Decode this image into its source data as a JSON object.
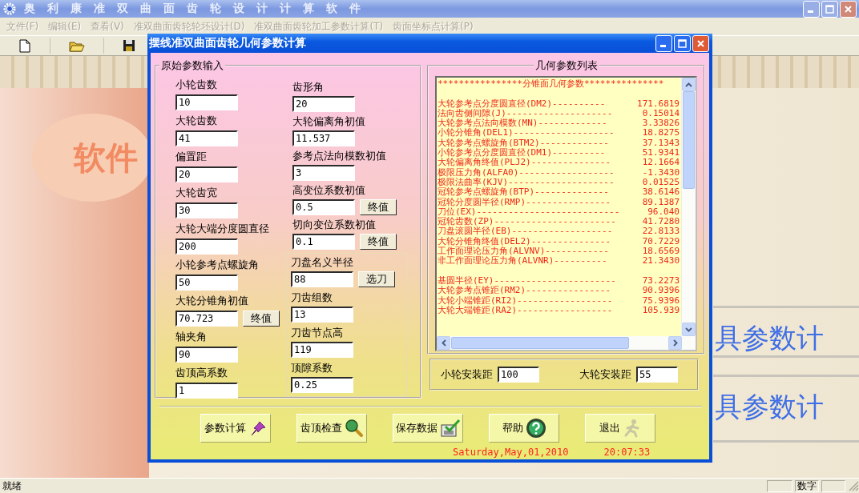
{
  "app": {
    "title": "奥利康准双曲面齿轮设计计算软件"
  },
  "menu": [
    {
      "label": "文件(F)",
      "disabled": true
    },
    {
      "label": "编辑(E)",
      "disabled": true
    },
    {
      "label": "查看(V)",
      "disabled": true
    },
    {
      "label": "准双曲面齿轮轮坯设计(D)",
      "disabled": true
    },
    {
      "label": "准双曲面齿轮加工参数计算(T)",
      "disabled": true
    },
    {
      "label": "齿面坐标点计算(P)",
      "disabled": true
    }
  ],
  "background_texts": {
    "logo": "软件",
    "line_1": "具参数计",
    "line_2": "具参数计"
  },
  "dialog": {
    "title": "摆线准双曲面齿轮几何参数计算",
    "input_group": {
      "legend": "原始参数输入",
      "left": [
        {
          "label": "小轮齿数",
          "value": "10"
        },
        {
          "label": "大轮齿数",
          "value": "41"
        },
        {
          "label": "偏置距",
          "value": "20"
        },
        {
          "label": "大轮齿宽",
          "value": "30"
        },
        {
          "label": "大轮大端分度圆直径",
          "value": "200"
        },
        {
          "label": "小轮参考点螺旋角",
          "value": "50"
        },
        {
          "label": "大轮分锥角初值",
          "value": "70.723",
          "button": "终值"
        },
        {
          "label": "轴夹角",
          "value": "90"
        },
        {
          "label": "齿顶高系数",
          "value": "1"
        }
      ],
      "right": [
        {
          "label": "齿形角",
          "value": "20"
        },
        {
          "label": "大轮偏离角初值",
          "value": "11.537"
        },
        {
          "label": "参考点法向模数初值",
          "value": "3"
        },
        {
          "label": "高变位系数初值",
          "value": "0.5",
          "button": "终值"
        },
        {
          "label": "切向变位系数初值",
          "value": "0.1",
          "button": "终值"
        }
      ],
      "cutter": [
        {
          "label": "刀盘名义半径",
          "value": "88",
          "button": "选刀"
        },
        {
          "label": "刀齿组数",
          "value": "13"
        },
        {
          "label": "刀齿节点高",
          "value": "119"
        },
        {
          "label": "顶隙系数",
          "value": "0.25"
        }
      ]
    },
    "list": {
      "legend": "几何参数列表",
      "header": "****************分锥面几何参数***************",
      "sections": [
        [
          {
            "name": "大轮参考点分度圆直径(DM2)----------",
            "value": "171.6819"
          },
          {
            "name": "法向齿侧间隙(J)--------------------",
            "value": "0.15014"
          },
          {
            "name": "大轮参考点法向模数(MN)-------------",
            "value": "3.33826"
          },
          {
            "name": "小轮分锥角(DEL1)-------------------",
            "value": "18.8275"
          },
          {
            "name": "大轮参考点螺旋角(BTM2)-------------",
            "value": "37.1343"
          },
          {
            "name": "小轮参考点分度圆直径(DM1)----------",
            "value": "51.9341"
          },
          {
            "name": "大轮偏离角终值(PLJ2)---------------",
            "value": "12.1664"
          },
          {
            "name": "极限压力角(ALFA0)------------------",
            "value": "-1.3430"
          },
          {
            "name": "极限法曲率(KJV)--------------------",
            "value": "0.01525"
          },
          {
            "name": "冠轮参考点螺旋角(BTP)--------------",
            "value": "38.6146"
          },
          {
            "name": "冠轮分度圆半径(RMP)----------------",
            "value": "89.1387"
          },
          {
            "name": "刀位(EX)---------------------------",
            "value": "96.040"
          },
          {
            "name": "冠轮齿数(ZP)-----------------------",
            "value": "41.7280"
          },
          {
            "name": "刀盘滚圆半径(EB)-------------------",
            "value": "22.8133"
          },
          {
            "name": "大轮分锥角终值(DEL2)---------------",
            "value": "70.7229"
          },
          {
            "name": "工作面理论压力角(ALVNV)------------",
            "value": "18.6569"
          },
          {
            "name": "非工作面理论压力角(ALVNR)----------",
            "value": "21.3430"
          }
        ],
        [
          {
            "name": "基圆半径(EY)-----------------------",
            "value": "73.2273"
          },
          {
            "name": "大轮参考点锥距(RM2)----------------",
            "value": "90.9396"
          },
          {
            "name": "大轮小端锥距(RI2)------------------",
            "value": "75.9396"
          },
          {
            "name": "大轮大端锥距(RA2)------------------",
            "value": "105.939"
          }
        ]
      ]
    },
    "install": [
      {
        "label": "小轮安装距",
        "value": "100"
      },
      {
        "label": "大轮安装距",
        "value": "55"
      }
    ],
    "buttons": [
      {
        "label": "参数计算"
      },
      {
        "label": "齿顶检查"
      },
      {
        "label": "保存数据"
      },
      {
        "label": "帮助"
      },
      {
        "label": "退出"
      }
    ],
    "date": "Saturday,May,01,2010",
    "time": "20:07:33"
  },
  "status_bar": {
    "text": "就绪",
    "indicator": "数字"
  }
}
